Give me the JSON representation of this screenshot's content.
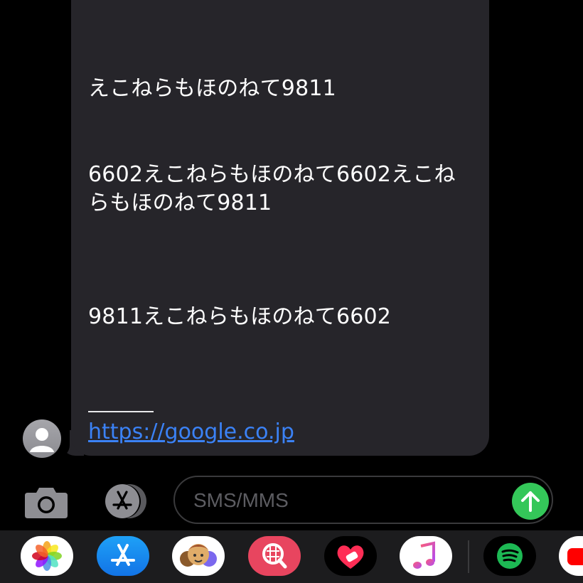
{
  "message": {
    "lines": [
      "えこねらもほのねて9811",
      "6602えこねらもほのねて6602えこね",
      "らもほのねて9811",
      "9811えこねらもほのねて6602"
    ],
    "link": "https://google.co.jp"
  },
  "input": {
    "placeholder": "SMS/MMS"
  },
  "icons": {
    "avatar": "contact-avatar-icon",
    "camera": "camera-icon",
    "appstore": "app-store-icon",
    "send": "send-arrow-icon"
  },
  "dock": {
    "apps": [
      "photos",
      "app-store",
      "memoji",
      "search-web",
      "heart-app",
      "music",
      "spotify",
      "youtube"
    ]
  },
  "colors": {
    "background": "#000000",
    "bubble": "#26252a",
    "link": "#3b82f6",
    "send": "#34c759",
    "dock": "#1c1c1e"
  }
}
